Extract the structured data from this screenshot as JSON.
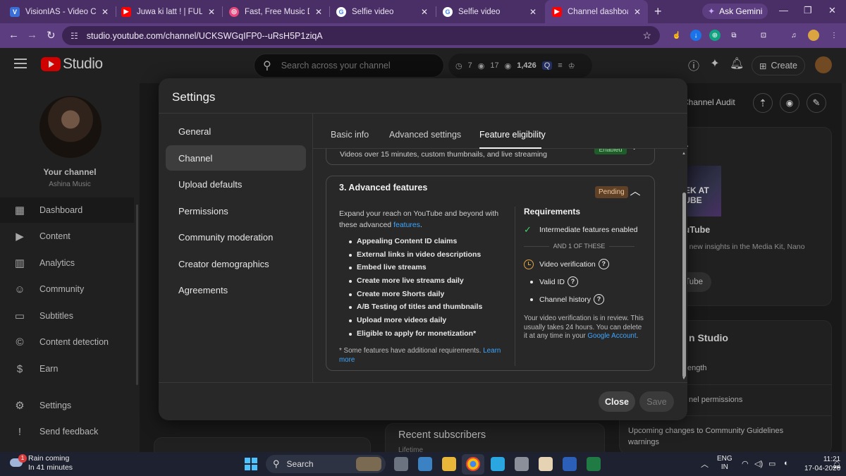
{
  "browser": {
    "tabs": [
      {
        "title": "VisionIAS - Video Class",
        "favicon_color": "#3a6fd8"
      },
      {
        "title": "Juwa ki latt ! | FULL MO",
        "favicon_color": "#ff0000"
      },
      {
        "title": "Fast, Free Music Distribu",
        "favicon_color": "#e8467c"
      },
      {
        "title": "Selfie video",
        "favicon_color": "#ffffff"
      },
      {
        "title": "Selfie video",
        "favicon_color": "#ffffff"
      },
      {
        "title": "Channel dashboard - Y",
        "favicon_color": "#ff0000"
      }
    ],
    "gemini_label": "Ask Gemini",
    "url": "studio.youtube.com/channel/UCKSWGqIFP0--uRsH5P1ziqA"
  },
  "studio": {
    "logo_text": "Studio",
    "search_placeholder": "Search across your channel",
    "stats": [
      "7",
      "17",
      "1,426"
    ],
    "create_label": "Create",
    "channel_audit_label": "Channel Audit",
    "channel_name": "Your channel",
    "channel_handle": "Ashina Music",
    "sidebar": [
      {
        "label": "Dashboard",
        "icon": "dashboard-icon",
        "glyph": "▦"
      },
      {
        "label": "Content",
        "icon": "content-icon",
        "glyph": "▶"
      },
      {
        "label": "Analytics",
        "icon": "analytics-icon",
        "glyph": "▥"
      },
      {
        "label": "Community",
        "icon": "community-icon",
        "glyph": "☺"
      },
      {
        "label": "Subtitles",
        "icon": "subtitles-icon",
        "glyph": "▭"
      },
      {
        "label": "Content detection",
        "icon": "content-detection-icon",
        "glyph": "©"
      },
      {
        "label": "Earn",
        "icon": "earn-icon",
        "glyph": "$"
      }
    ],
    "sidebar_bottom": [
      {
        "label": "Settings",
        "icon": "gear-icon",
        "glyph": "⚙"
      },
      {
        "label": "Send feedback",
        "icon": "feedback-icon",
        "glyph": "!"
      }
    ],
    "bg": {
      "card_heading_fragment": "er",
      "thumb_text": "EEK AT\nTUBE",
      "youtube_fragment": "ouTube",
      "media_kit_text": "ng new insights in the Media Kit, Nano\nte",
      "tube_btn": "Tube",
      "studio_fragment": "n Studio",
      "length_fragment": "ength",
      "permissions_fragment": "nel permissions",
      "guidelines_text": "Upcoming changes to Community Guidelines\nwarnings",
      "recent_subscribers": "Recent subscribers",
      "lifetime": "Lifetime"
    }
  },
  "modal": {
    "title": "Settings",
    "nav": [
      "General",
      "Channel",
      "Upload defaults",
      "Permissions",
      "Community moderation",
      "Creator demographics",
      "Agreements"
    ],
    "tabs": [
      "Basic info",
      "Advanced settings",
      "Feature eligibility"
    ],
    "previous_card": {
      "description": "Videos over 15 minutes, custom thumbnails, and live streaming",
      "badge": "Enabled"
    },
    "advanced": {
      "title": "3. Advanced features",
      "badge": "Pending",
      "intro": "Expand your reach on YouTube and beyond with these advanced ",
      "intro_link": "features",
      "intro_end": ".",
      "features": [
        "Appealing Content ID claims",
        "External links in video descriptions",
        "Embed live streams",
        "Create more live streams daily",
        "Create more Shorts daily",
        "A/B Testing of titles and thumbnails",
        "Upload more videos daily",
        "Eligible to apply for monetization*"
      ],
      "footnote": "* Some features have additional requirements. ",
      "footnote_link": "Learn more",
      "requirements_title": "Requirements",
      "req_met": "Intermediate features enabled",
      "and_one": "AND 1 OF THESE",
      "options": [
        "Video verification",
        "Valid ID",
        "Channel history"
      ],
      "review_note": "Your video verification is in review. This usually takes 24 hours. You can delete it at any time in your ",
      "review_link": "Google Account",
      "review_end": "."
    },
    "close_label": "Close",
    "save_label": "Save"
  },
  "taskbar": {
    "weather_line1": "Rain coming",
    "weather_line2": "In 41 minutes",
    "notification_count": "1",
    "search_label": "Search",
    "lang_line1": "ENG",
    "lang_line2": "IN",
    "time": "11:21",
    "date": "17-04-2026"
  }
}
